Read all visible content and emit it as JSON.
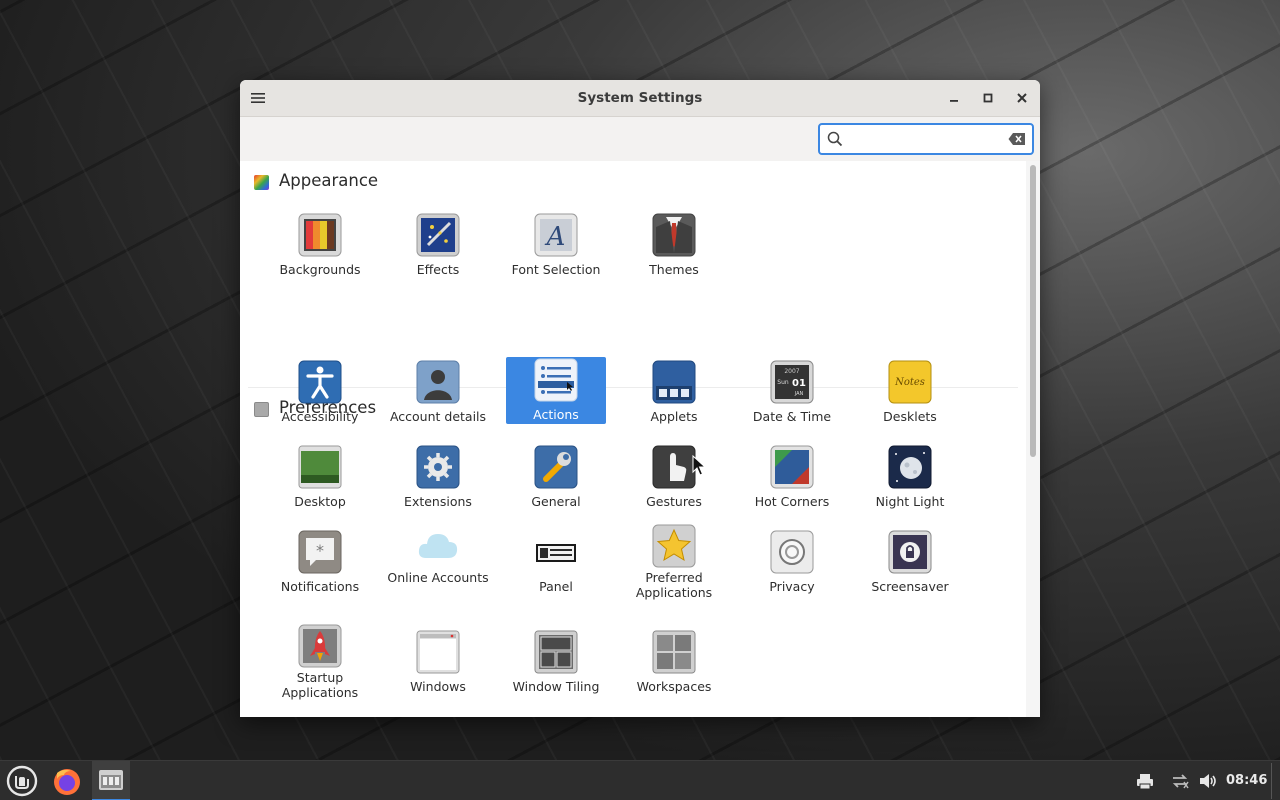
{
  "window": {
    "title": "System Settings"
  },
  "search": {
    "value": "",
    "placeholder": ""
  },
  "sections": [
    {
      "label": "Appearance",
      "items": [
        {
          "label": "Backgrounds",
          "icon": "backgrounds-icon"
        },
        {
          "label": "Effects",
          "icon": "effects-icon"
        },
        {
          "label": "Font Selection",
          "icon": "font-selection-icon"
        },
        {
          "label": "Themes",
          "icon": "themes-icon"
        }
      ]
    },
    {
      "label": "Preferences",
      "items": [
        {
          "label": "Accessibility",
          "icon": "accessibility-icon"
        },
        {
          "label": "Account details",
          "icon": "account-details-icon"
        },
        {
          "label": "Actions",
          "icon": "actions-icon",
          "selected": true
        },
        {
          "label": "Applets",
          "icon": "applets-icon"
        },
        {
          "label": "Date & Time",
          "icon": "date-time-icon"
        },
        {
          "label": "Desklets",
          "icon": "desklets-icon"
        },
        {
          "label": "Desktop",
          "icon": "desktop-icon"
        },
        {
          "label": "Extensions",
          "icon": "extensions-icon"
        },
        {
          "label": "General",
          "icon": "general-icon"
        },
        {
          "label": "Gestures",
          "icon": "gestures-icon"
        },
        {
          "label": "Hot Corners",
          "icon": "hot-corners-icon"
        },
        {
          "label": "Night Light",
          "icon": "night-light-icon"
        },
        {
          "label": "Notifications",
          "icon": "notifications-icon"
        },
        {
          "label": "Online Accounts",
          "icon": "online-accounts-icon"
        },
        {
          "label": "Panel",
          "icon": "panel-icon"
        },
        {
          "label": "Preferred Applications",
          "icon": "preferred-applications-icon"
        },
        {
          "label": "Privacy",
          "icon": "privacy-icon"
        },
        {
          "label": "Screensaver",
          "icon": "screensaver-icon"
        },
        {
          "label": "Startup Applications",
          "icon": "startup-applications-icon"
        },
        {
          "label": "Windows",
          "icon": "windows-icon"
        },
        {
          "label": "Window Tiling",
          "icon": "window-tiling-icon"
        },
        {
          "label": "Workspaces",
          "icon": "workspaces-icon"
        }
      ]
    }
  ],
  "date_time_icon_text": {
    "year": "2007",
    "day": "01",
    "month": "JAN",
    "weekday": "Sun"
  },
  "desklets_icon_text": "Notes",
  "taskbar": {
    "clock": "08:46",
    "apps": [
      "menu-icon",
      "firefox-icon",
      "system-settings-icon"
    ],
    "tray": [
      "printer-icon",
      "network-icon",
      "volume-icon"
    ]
  },
  "colors": {
    "accent": "#3b87e2",
    "panel": "#2d2d2d",
    "titlebar": "#e6e4e1"
  }
}
